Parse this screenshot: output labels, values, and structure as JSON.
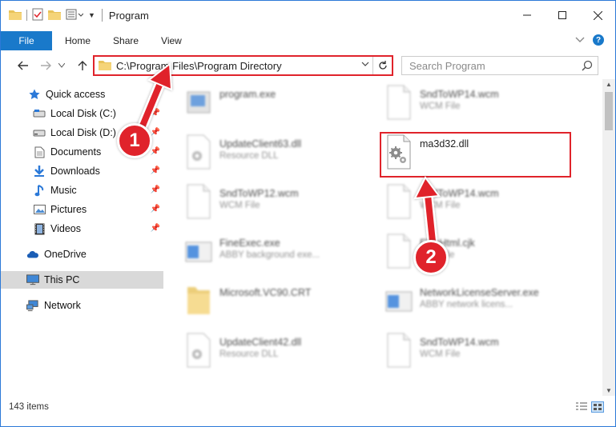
{
  "window": {
    "title": "Program"
  },
  "ribbon": {
    "file": "File",
    "tabs": [
      "Home",
      "Share",
      "View"
    ],
    "help": "?"
  },
  "address": {
    "path": "C:\\Program Files\\Program Directory"
  },
  "search": {
    "placeholder": "Search Program"
  },
  "sidebar": {
    "quick_access": "Quick access",
    "items": [
      {
        "label": "Local Disk (C:)",
        "icon": "drive-icon"
      },
      {
        "label": "Local Disk (D:)",
        "icon": "drive-icon"
      },
      {
        "label": "Documents",
        "icon": "documents-icon"
      },
      {
        "label": "Downloads",
        "icon": "downloads-icon"
      },
      {
        "label": "Music",
        "icon": "music-icon"
      },
      {
        "label": "Pictures",
        "icon": "pictures-icon"
      },
      {
        "label": "Videos",
        "icon": "videos-icon"
      }
    ],
    "onedrive": "OneDrive",
    "this_pc": "This PC",
    "network": "Network"
  },
  "files": [
    {
      "name": "program.exe",
      "type": ""
    },
    {
      "name": "SndToWP14.wcm",
      "type": "WCM File"
    },
    {
      "name": "UpdateClient63.dll",
      "type": "Resource DLL"
    },
    {
      "name": "ma3d32.dll",
      "type": ""
    },
    {
      "name": "SndToWP12.wcm",
      "type": "WCM File"
    },
    {
      "name": "SndToWP14.wcm",
      "type": "WCM File"
    },
    {
      "name": "FineExec.exe",
      "type": "ABBY background exe..."
    },
    {
      "name": "FineHtml.cjk",
      "type": "CJK File"
    },
    {
      "name": "Microsoft.VC90.CRT",
      "type": ""
    },
    {
      "name": "NetworkLicenseServer.exe",
      "type": "ABBY network licens..."
    },
    {
      "name": "UpdateClient42.dll",
      "type": "Resource DLL"
    },
    {
      "name": "SndToWP14.wcm",
      "type": "WCM File"
    }
  ],
  "status": {
    "count": "143 items"
  },
  "annotations": {
    "step1": "1",
    "step2": "2"
  },
  "colors": {
    "accent": "#1979ca",
    "highlight": "#e0232b"
  }
}
